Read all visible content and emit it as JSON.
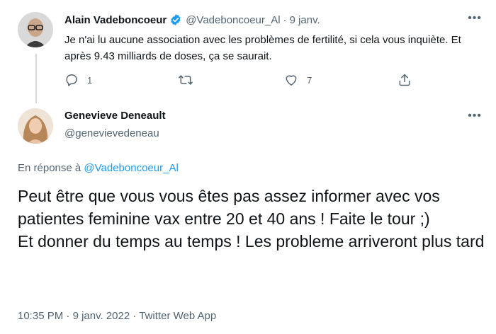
{
  "tweet1": {
    "name": "Alain Vadeboncoeur",
    "handle": "@Vadeboncoeur_Al",
    "separator": "·",
    "date": "9 janv.",
    "more": "•••",
    "text": "Je n'ai lu aucune association avec les problèmes de fertilité, si cela vous inquiète. Et après 9.43 milliards de doses, ça se saurait.",
    "reply_count": "1",
    "retweet_count": "",
    "like_count": "7"
  },
  "tweet2": {
    "name": "Genevieve Deneault",
    "handle": "@genevievedeneau",
    "more": "•••",
    "reply_prefix": "En réponse à ",
    "reply_handle": "@Vadeboncoeur_Al",
    "text_line1": "Peut être que vous vous êtes pas assez informer avec vos patientes feminine vax entre 20 et 40 ans ! Faite le tour ;)",
    "text_line2": "Et donner du temps au temps ! Les probleme arriveront plus tard",
    "time": "10:35 PM",
    "separator": "·",
    "date": "9 janv. 2022",
    "app": "Twitter Web App"
  },
  "colors": {
    "accent": "#1d9bf0",
    "text": "#0f1419",
    "secondary": "#536471"
  }
}
